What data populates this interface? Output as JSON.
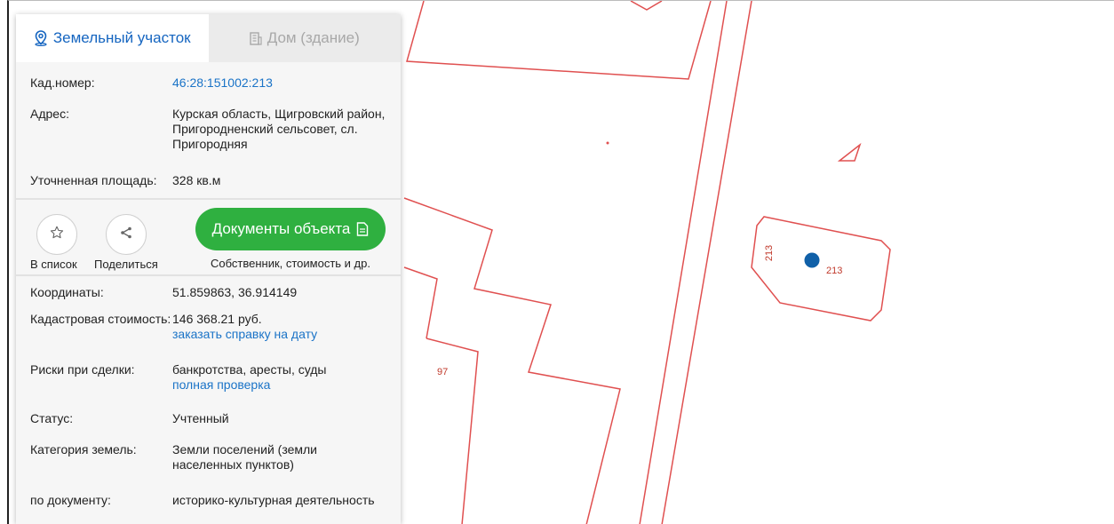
{
  "tabs": [
    {
      "label": "Земельный участок",
      "icon": "location-pin-icon",
      "active": true
    },
    {
      "label": "Дом (здание)",
      "icon": "building-icon",
      "active": false
    }
  ],
  "info_top": [
    {
      "key": "Кад.номер:",
      "value": "46:28:151002:213",
      "is_link": true
    },
    {
      "key": "Адрес:",
      "value": "Курская область, Щигровский район, Пригородненский сельсовет, сл. Пригородняя"
    },
    {
      "key": "Уточненная площадь:",
      "value": "328 кв.м"
    }
  ],
  "actions": {
    "favorite_label": "В список",
    "share_label": "Поделиться",
    "documents_button": "Документы объекта",
    "documents_sub": "Собственник, стоимость и др."
  },
  "info_bottom": [
    {
      "key": "Координаты:",
      "value": "51.859863, 36.914149"
    },
    {
      "key": "Кадастровая стоимость:",
      "value": "146 368.21 руб.",
      "link": "заказать справку на дату"
    },
    {
      "key": "Риски при сделки:",
      "value": "банкротства, аресты, суды",
      "link": "полная проверка"
    },
    {
      "key": "Статус:",
      "value": "Учтенный"
    },
    {
      "key": "Категория земель:",
      "value": "Земли поселений (земли населенных пунктов)"
    },
    {
      "key": "по документу:",
      "value": "историко-культурная деятельность"
    }
  ],
  "map": {
    "labels": {
      "parcel_97": "97",
      "parcel_213_v": "213",
      "parcel_213_h": "213"
    },
    "colors": {
      "boundary": "#e05050",
      "marker": "#1060a8",
      "accent": "#1565c0",
      "button": "#2fb040"
    }
  }
}
